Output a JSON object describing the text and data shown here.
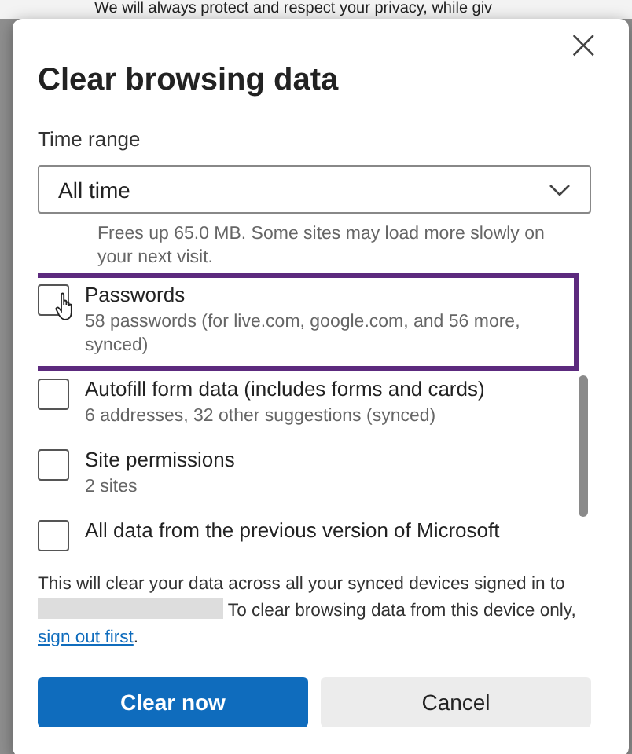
{
  "backdrop_text": "We will always protect and respect your privacy, while giv",
  "dialog": {
    "title": "Clear browsing data",
    "close": "×"
  },
  "time_range": {
    "label": "Time range",
    "value": "All time"
  },
  "list": {
    "partial_description": "Frees up 65.0 MB. Some sites may load more slowly on your next visit.",
    "items": [
      {
        "title": "Passwords",
        "description": "58 passwords (for live.com, google.com, and 56 more, synced)",
        "checked": false,
        "highlighted": true
      },
      {
        "title": "Autofill form data (includes forms and cards)",
        "description": "6 addresses, 32 other suggestions (synced)",
        "checked": false,
        "highlighted": false
      },
      {
        "title": "Site permissions",
        "description": "2 sites",
        "checked": false,
        "highlighted": false
      },
      {
        "title": "All data from the previous version of Microsoft",
        "checked": false,
        "highlighted": false
      }
    ]
  },
  "notice": {
    "text_before": "This will clear your data across all your synced devices signed in to",
    "text_after": "To clear browsing data from this device only,",
    "link": "sign out first",
    "end": "."
  },
  "buttons": [
    {
      "label": "Clear now",
      "kind": "primary"
    },
    {
      "label": "Cancel",
      "kind": "secondary"
    }
  ]
}
